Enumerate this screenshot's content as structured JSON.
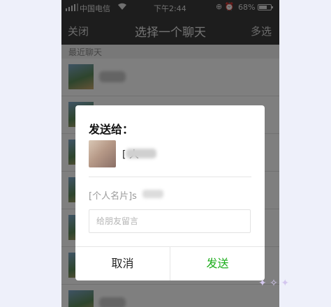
{
  "status_bar": {
    "carrier": "中国电信",
    "time": "下午2:44",
    "battery_percent": "68%",
    "battery_level": 0.68
  },
  "nav": {
    "close_label": "关闭",
    "title": "选择一个聊天",
    "multi_select_label": "多选"
  },
  "recent_section": "最近聊天",
  "chat_rows": [
    {
      "name": ""
    },
    {
      "name": ""
    },
    {
      "name": ""
    },
    {
      "name": ""
    },
    {
      "name": ""
    },
    {
      "name": ""
    },
    {
      "name": ""
    }
  ],
  "dialog": {
    "heading": "发送给：",
    "recipient_name": "[     大",
    "card_label": "[个人名片]s",
    "message_placeholder": "给朋友留言",
    "cancel_label": "取消",
    "send_label": "发送"
  },
  "colors": {
    "send_green": "#1aad19",
    "nav_bg": "#3b3b3b"
  }
}
